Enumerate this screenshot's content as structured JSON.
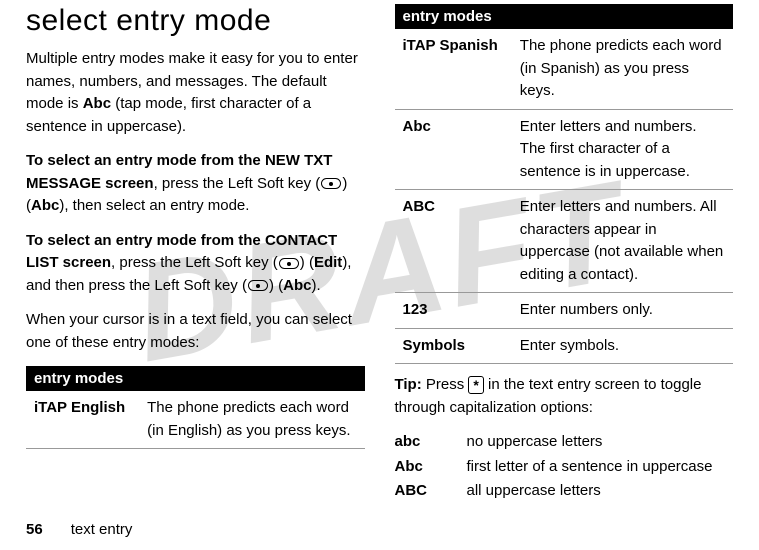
{
  "watermark": "DRAFT",
  "page_number": "56",
  "footer_section": "text entry",
  "left": {
    "heading": "select entry mode",
    "p1_a": "Multiple entry modes make it easy for you to enter names, numbers, and messages. The default mode is ",
    "p1_abc": "Abc",
    "p1_b": " (tap mode, first character of a sentence in uppercase).",
    "p2_bold_a": "To select an entry mode from the ",
    "p2_cond_a": "NEW TXT MESSAGE",
    "p2_bold_b": " screen",
    "p2_txt_a": ", press the Left Soft key (",
    "p2_txt_b": ") (",
    "p2_cond_b": "Abc",
    "p2_txt_c": "), then select an entry mode.",
    "p3_bold_a": "To select an entry mode from the ",
    "p3_cond_a": "CONTACT LIST",
    "p3_bold_b": " screen",
    "p3_txt_a": ", press the Left Soft key (",
    "p3_txt_b": ") (",
    "p3_cond_b": "Edit",
    "p3_txt_c": "), and then press the Left Soft key (",
    "p3_txt_d": ") (",
    "p3_cond_c": "Abc",
    "p3_txt_e": ").",
    "p4": "When your cursor is in a text field, you can select one of these entry modes:",
    "table_header": "entry modes",
    "row_label": "iTAP English",
    "row_desc": "The phone predicts each word (in English) as you press keys."
  },
  "right": {
    "table_header": "entry modes",
    "rows": [
      {
        "label": "iTAP Spanish",
        "desc": "The phone predicts each word (in Spanish) as you press keys."
      },
      {
        "label": "Abc",
        "desc": "Enter letters and numbers. The first character of a sentence is in uppercase."
      },
      {
        "label": "ABC",
        "desc": "Enter letters and numbers. All characters appear in uppercase (not available when editing a contact)."
      },
      {
        "label": "123",
        "desc": "Enter numbers only."
      },
      {
        "label": "Symbols",
        "desc": "Enter symbols."
      }
    ],
    "tip_bold": "Tip:",
    "tip_a": " Press ",
    "tip_star": "*",
    "tip_b": " in the text entry screen to toggle through capitalization options:",
    "caps": [
      {
        "label": "abc",
        "desc": "no uppercase letters"
      },
      {
        "label": "Abc",
        "desc": "first letter of a sentence in uppercase"
      },
      {
        "label": "ABC",
        "desc": "all uppercase letters"
      }
    ]
  }
}
